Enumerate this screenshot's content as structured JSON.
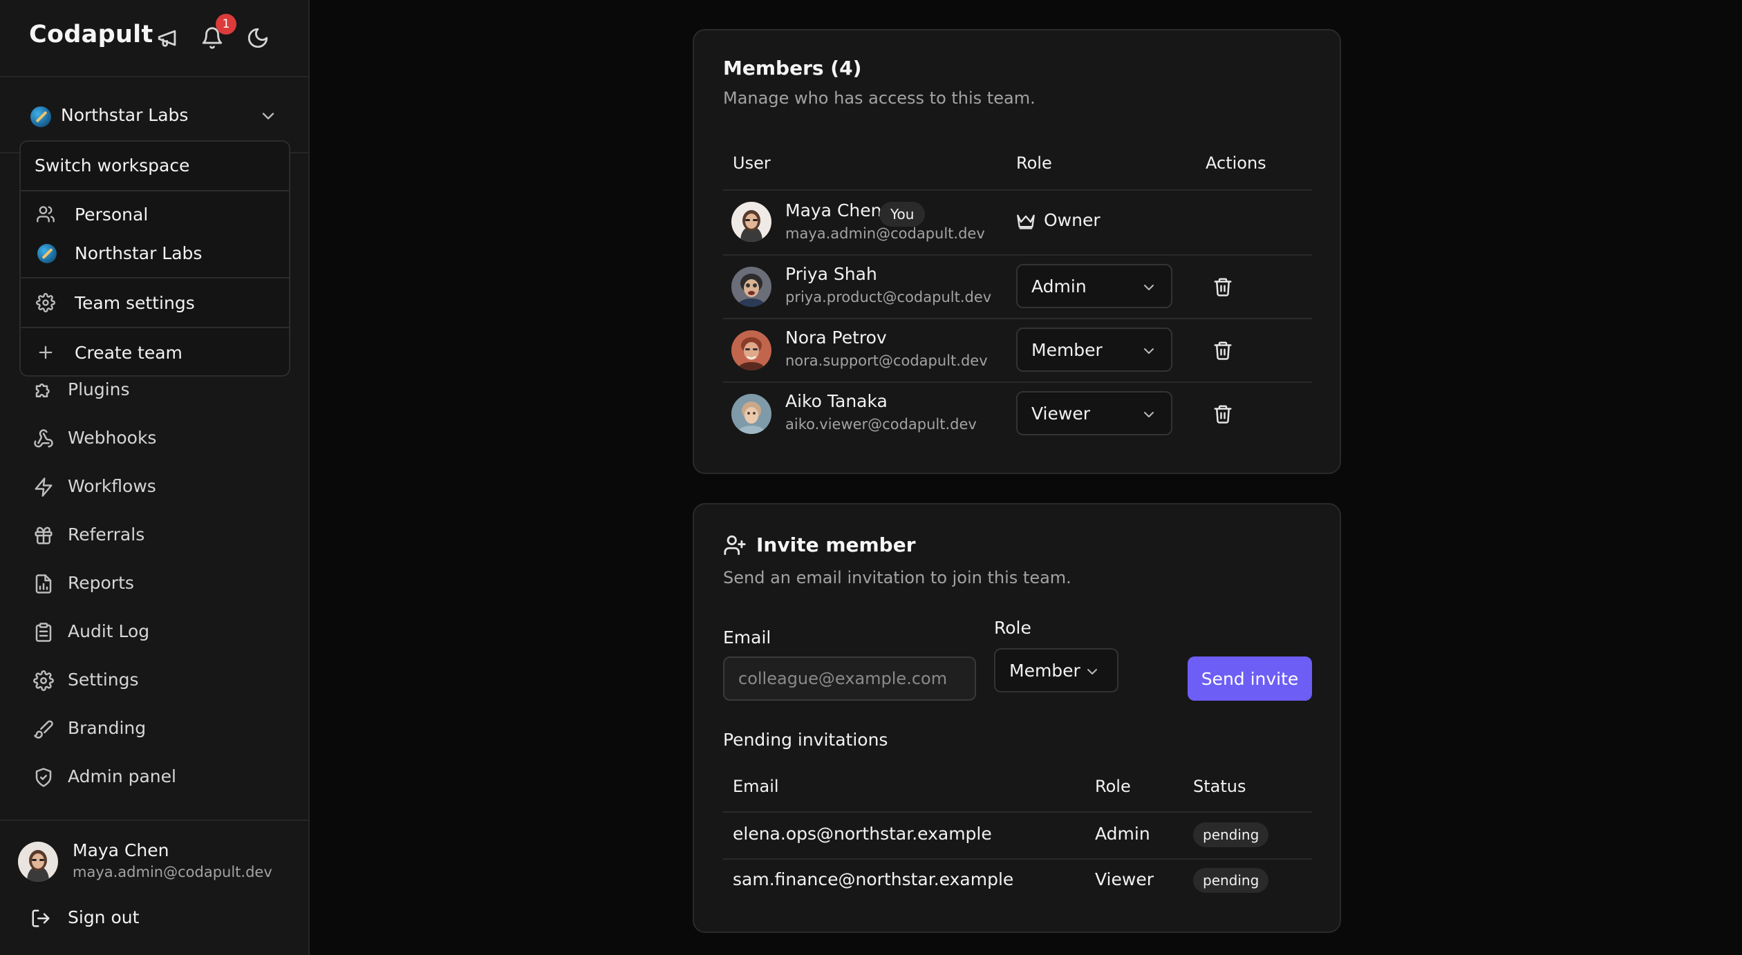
{
  "sidebar": {
    "brand": "Codapult",
    "notification_count": "1",
    "workspace": "Northstar Labs",
    "dropdown": {
      "title": "Switch workspace",
      "items": [
        {
          "label": "Personal",
          "icon": "users-icon"
        },
        {
          "label": "Northstar Labs",
          "icon": "workspace-logo"
        },
        {
          "label": "Team settings",
          "icon": "gear-icon"
        },
        {
          "label": "Create team",
          "icon": "plus-icon"
        }
      ]
    },
    "nav": [
      {
        "label": "Plugins",
        "icon": "puzzle-icon"
      },
      {
        "label": "Webhooks",
        "icon": "webhook-icon"
      },
      {
        "label": "Workflows",
        "icon": "zap-icon"
      },
      {
        "label": "Referrals",
        "icon": "gift-icon"
      },
      {
        "label": "Reports",
        "icon": "report-icon"
      },
      {
        "label": "Audit Log",
        "icon": "clipboard-icon"
      },
      {
        "label": "Settings",
        "icon": "gear-icon"
      },
      {
        "label": "Branding",
        "icon": "brush-icon"
      },
      {
        "label": "Admin panel",
        "icon": "shield-icon"
      }
    ],
    "user": {
      "name": "Maya Chen",
      "email": "maya.admin@codapult.dev"
    },
    "sign_out": "Sign out"
  },
  "members": {
    "title": "Members (4)",
    "subtitle": "Manage who has access to this team.",
    "headers": {
      "user": "User",
      "role": "Role",
      "actions": "Actions"
    },
    "rows": [
      {
        "name": "Maya Chen",
        "email": "maya.admin@codapult.dev",
        "you": "You",
        "role": "Owner"
      },
      {
        "name": "Priya Shah",
        "email": "priya.product@codapult.dev",
        "role": "Admin"
      },
      {
        "name": "Nora Petrov",
        "email": "nora.support@codapult.dev",
        "role": "Member"
      },
      {
        "name": "Aiko Tanaka",
        "email": "aiko.viewer@codapult.dev",
        "role": "Viewer"
      }
    ]
  },
  "invite": {
    "title": "Invite member",
    "subtitle": "Send an email invitation to join this team.",
    "email_label": "Email",
    "email_placeholder": "colleague@example.com",
    "role_label": "Role",
    "role_value": "Member",
    "send_label": "Send invite",
    "pending_title": "Pending invitations",
    "pending_headers": {
      "email": "Email",
      "role": "Role",
      "status": "Status"
    },
    "pending": [
      {
        "email": "elena.ops@northstar.example",
        "role": "Admin",
        "status": "pending"
      },
      {
        "email": "sam.finance@northstar.example",
        "role": "Viewer",
        "status": "pending"
      }
    ]
  },
  "colors": {
    "accent": "#6d5ef5",
    "badge": "#dc3b3b",
    "background": "#090909",
    "surface": "#171717"
  }
}
